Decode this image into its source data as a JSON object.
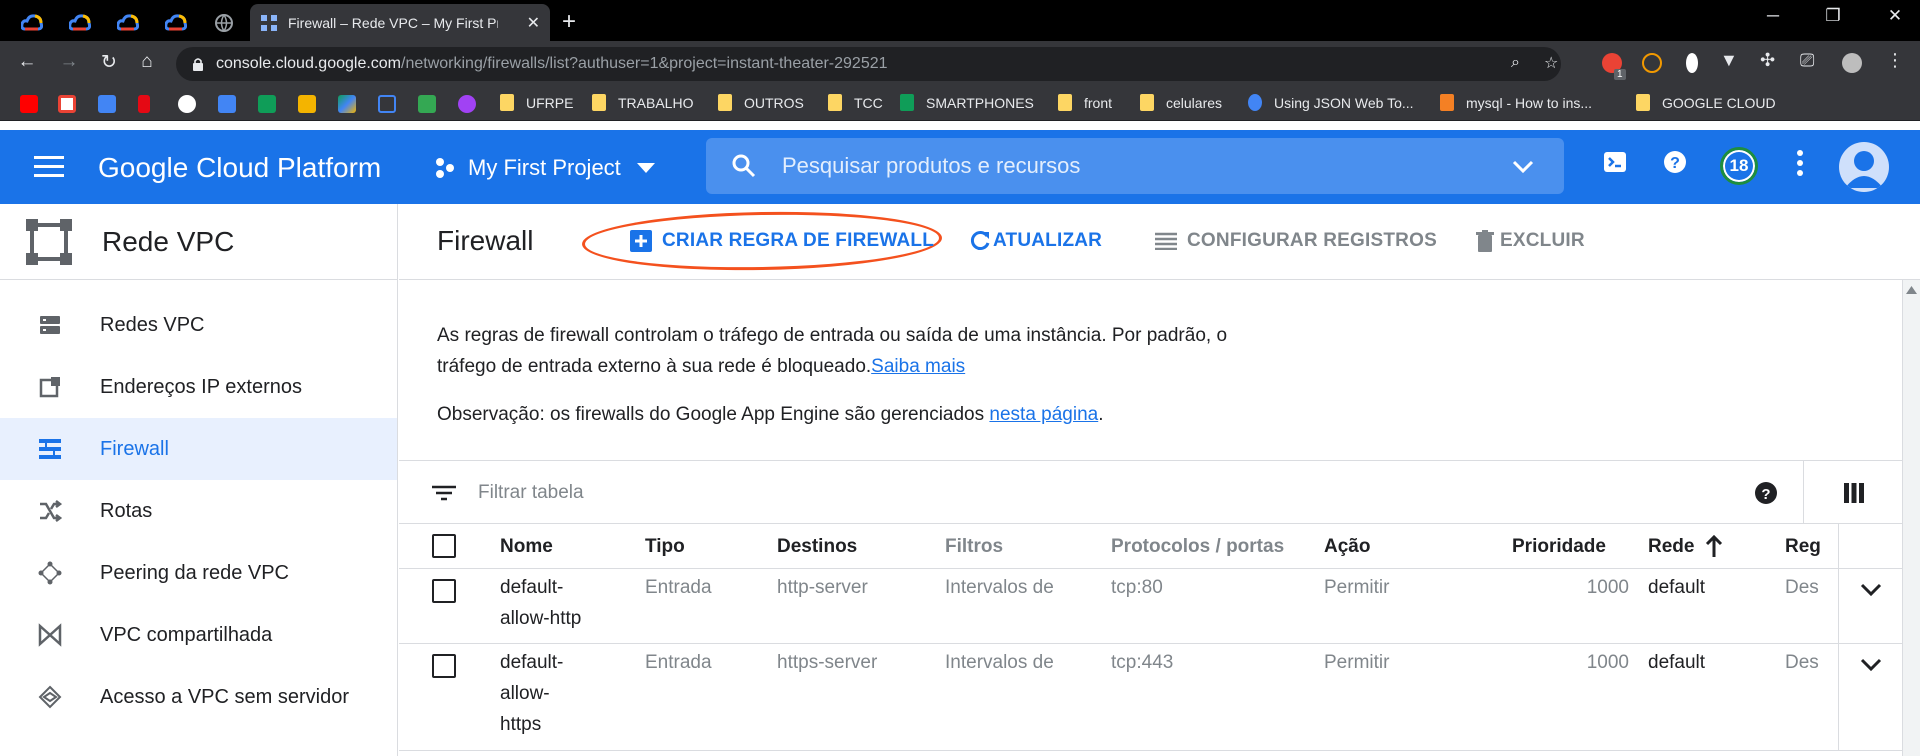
{
  "browser": {
    "active_tab_title": "Firewall – Rede VPC – My First Project",
    "url_host": "console.cloud.google.com",
    "url_path": "/networking/firewalls/list?authuser=1&project=instant-theater-292521",
    "bookmarks": [
      "UFRPE",
      "TRABALHO",
      "OUTROS",
      "TCC",
      "SMARTPHONES",
      "front",
      "celulares",
      "Using JSON Web To...",
      "mysql - How to ins...",
      "GOOGLE CLOUD"
    ],
    "extension_badge": "1"
  },
  "header": {
    "title": "Google Cloud Platform",
    "project": "My First Project",
    "search_placeholder": "Pesquisar produtos e recursos",
    "notification_count": "18"
  },
  "sidebar": {
    "title": "Rede VPC",
    "items": [
      {
        "label": "Redes VPC"
      },
      {
        "label": "Endereços IP externos"
      },
      {
        "label": "Firewall"
      },
      {
        "label": "Rotas"
      },
      {
        "label": "Peering da rede VPC"
      },
      {
        "label": "VPC compartilhada"
      },
      {
        "label": "Acesso a VPC sem servidor"
      }
    ]
  },
  "toolbar": {
    "page_title": "Firewall",
    "create_label": "CRIAR REGRA DE FIREWALL",
    "refresh_label": "ATUALIZAR",
    "logs_label": "CONFIGURAR REGISTROS",
    "delete_label": "EXCLUIR"
  },
  "info": {
    "text": "As regras de firewall controlam o tráfego de entrada ou saída de uma instância. Por padrão, o tráfego de entrada externo à sua rede é bloqueado.",
    "learn_more": "Saiba mais",
    "note_prefix": "Observação: os firewalls do Google App Engine são gerenciados ",
    "note_link": "nesta página",
    "note_suffix": "."
  },
  "filter": {
    "placeholder": "Filtrar tabela"
  },
  "table": {
    "columns": [
      "Nome",
      "Tipo",
      "Destinos",
      "Filtros",
      "Protocolos / portas",
      "Ação",
      "Prioridade",
      "Rede",
      "Reg"
    ],
    "rows": [
      {
        "name": "default-\nallow-http",
        "type": "Entrada",
        "targets": "http-server",
        "filters": "Intervalos de",
        "protocols": "tcp:80",
        "action": "Permitir",
        "priority": "1000",
        "network": "default",
        "logs": "Des"
      },
      {
        "name": "default-\nallow-\nhttps",
        "type": "Entrada",
        "targets": "https-server",
        "filters": "Intervalos de",
        "protocols": "tcp:443",
        "action": "Permitir",
        "priority": "1000",
        "network": "default",
        "logs": "Des"
      }
    ]
  },
  "colors": {
    "brand": "#1a73e8",
    "annotation": "#f4511e"
  }
}
